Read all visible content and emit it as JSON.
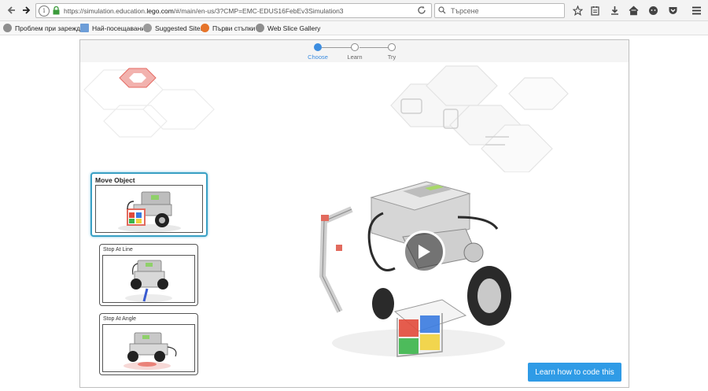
{
  "browser": {
    "url_prefix": "https://simulation.education.",
    "url_domain": "lego.com",
    "url_suffix": "/#/main/en-us/3?CMP=EMC-EDUS16FebEv3Simulation3",
    "search_placeholder": "Търсене"
  },
  "bookmarks": [
    {
      "label": "Проблем при зарежд..."
    },
    {
      "label": "Най-посещавани"
    },
    {
      "label": "Suggested Sites"
    },
    {
      "label": "Първи стъпки"
    },
    {
      "label": "Web Slice Gallery"
    }
  ],
  "steps": [
    {
      "label": "Choose"
    },
    {
      "label": "Learn"
    },
    {
      "label": "Try"
    }
  ],
  "cards": [
    {
      "title": "Move Object"
    },
    {
      "title": "Stop At Line"
    },
    {
      "title": "Stop At Angle"
    }
  ],
  "learn_button": "Learn how to code this",
  "colors": {
    "accent": "#3c8de0",
    "button": "#2f9be6",
    "selected_border": "#3aa0c4"
  }
}
